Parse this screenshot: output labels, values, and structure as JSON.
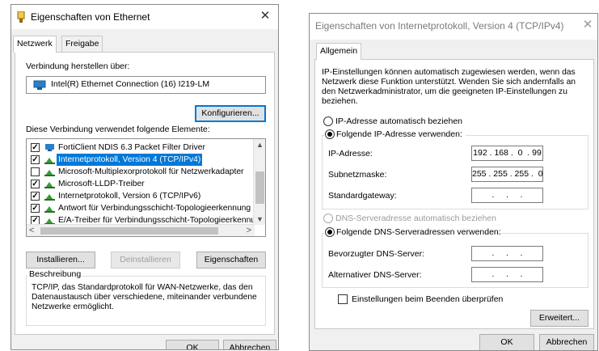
{
  "ethernet_dialog": {
    "title": "Eigenschaften von Ethernet",
    "tabs": [
      "Netzwerk",
      "Freigabe"
    ],
    "connect_using_label": "Verbindung herstellen über:",
    "adapter_name": "Intel(R) Ethernet Connection (16) I219-LM",
    "configure_button": "Konfigurieren...",
    "items_label": "Diese Verbindung verwendet folgende Elemente:",
    "items": [
      {
        "label": "FortiClient NDIS 6.3 Packet Filter Driver",
        "checked": true,
        "selected": false,
        "icon": "network-filter-icon"
      },
      {
        "label": "Internetprotokoll, Version 4 (TCP/IPv4)",
        "checked": true,
        "selected": true,
        "icon": "protocol-icon"
      },
      {
        "label": "Microsoft-Multiplexorprotokoll für Netzwerkadapter",
        "checked": false,
        "selected": false,
        "icon": "protocol-icon"
      },
      {
        "label": "Microsoft-LLDP-Treiber",
        "checked": true,
        "selected": false,
        "icon": "protocol-icon"
      },
      {
        "label": "Internetprotokoll, Version 6 (TCP/IPv6)",
        "checked": true,
        "selected": false,
        "icon": "protocol-icon"
      },
      {
        "label": "Antwort für Verbindungsschicht-Topologieerkennung",
        "checked": true,
        "selected": false,
        "icon": "protocol-icon"
      },
      {
        "label": "E/A-Treiber für Verbindungsschicht-Topologieerkennur",
        "checked": true,
        "selected": false,
        "icon": "protocol-icon"
      }
    ],
    "install_button": "Installieren...",
    "uninstall_button": "Deinstallieren",
    "properties_button": "Eigenschaften",
    "description_label": "Beschreibung",
    "description_text": "TCP/IP, das Standardprotokoll für WAN-Netzwerke, das den Datenaustausch über verschiedene, miteinander verbundene Netzwerke ermöglicht.",
    "ok_button": "OK",
    "cancel_button": "Abbrechen"
  },
  "ipv4_dialog": {
    "title": "Eigenschaften von Internetprotokoll, Version 4 (TCP/IPv4)",
    "tab": "Allgemein",
    "info_text": "IP-Einstellungen können automatisch zugewiesen werden, wenn das Netzwerk diese Funktion unterstützt. Wenden Sie sich andernfalls an den Netzwerkadministrator, um die geeigneten IP-Einstellungen zu beziehen.",
    "auto_ip_label": "IP-Adresse automatisch beziehen",
    "manual_ip_label": "Folgende IP-Adresse verwenden:",
    "ip_address_label": "IP-Adresse:",
    "ip_address_value": "192 . 168 .  0  . 99",
    "subnet_label": "Subnetzmaske:",
    "subnet_value": "255 . 255 . 255 .  0",
    "gateway_label": "Standardgateway:",
    "gateway_value": " .     .     . ",
    "auto_dns_label": "DNS-Serveradresse automatisch beziehen",
    "manual_dns_label": "Folgende DNS-Serveradressen verwenden:",
    "preferred_dns_label": "Bevorzugter DNS-Server:",
    "preferred_dns_value": " .     .     . ",
    "alternate_dns_label": "Alternativer DNS-Server:",
    "alternate_dns_value": " .     .     . ",
    "validate_label": "Einstellungen beim Beenden überprüfen",
    "advanced_button": "Erweitert...",
    "ok_button": "OK",
    "cancel_button": "Abbrechen"
  },
  "colors": {
    "selection": "#0078d7",
    "dialog_bg": "#f0f0f0",
    "network_icon": "#2a7fc9",
    "protocol_icon": "#3a9b3a"
  }
}
